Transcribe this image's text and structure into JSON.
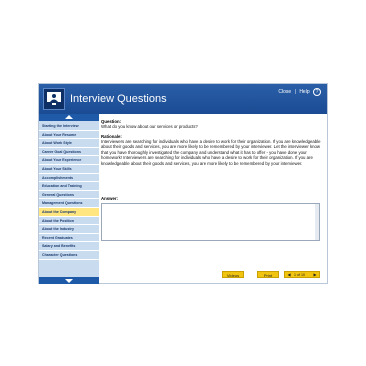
{
  "header": {
    "title": "Interview Questions",
    "close_label": "Close",
    "separator": "|",
    "help_label": "Help",
    "help_glyph": "?"
  },
  "sidebar": {
    "items": [
      {
        "label": "Starting the Interview",
        "active": false
      },
      {
        "label": "About Your Resume",
        "active": false
      },
      {
        "label": "About Work Style",
        "active": false
      },
      {
        "label": "Career Goal Questions",
        "active": false
      },
      {
        "label": "About Your Experience",
        "active": false
      },
      {
        "label": "About Your Skills",
        "active": false
      },
      {
        "label": "Accomplishments",
        "active": false
      },
      {
        "label": "Education and Training",
        "active": false
      },
      {
        "label": "General Questions",
        "active": false
      },
      {
        "label": "Management Questions",
        "active": false
      },
      {
        "label": "About the Company",
        "active": true
      },
      {
        "label": "About the Position",
        "active": false
      },
      {
        "label": "About the Industry",
        "active": false
      },
      {
        "label": "Recent Graduates",
        "active": false
      },
      {
        "label": "Salary and Benefits",
        "active": false
      },
      {
        "label": "Character Questions",
        "active": false
      }
    ]
  },
  "content": {
    "question_label": "Question:",
    "question_text": "What do you know about our services or products?",
    "rationale_label": "Rationale:",
    "rationale_text": "Interviewers are searching for individuals who have a desire to work for their organization. If you are knowledgeable about their goods and services, you are more likely to be remembered by your interviewer. Let the interviewer know that you have thoroughly investigated the company and understand what it has to offer - you have done your homework! Interviewers are searching for individuals who have a desire to work for their organization. If you are knowledgeable about their goods and services, you are more likely to be remembered by your interviewer.",
    "answer_label": "Answer:",
    "answer_value": ""
  },
  "footer": {
    "videos_label": "Videos",
    "print_label": "Print",
    "pager_text": "1 of 10",
    "prev_glyph": "◀",
    "next_glyph": "▶"
  },
  "colors": {
    "header_blue": "#1f5399",
    "sidebar_bg": "#c9dbef",
    "active_item": "#ffe680",
    "button_yellow": "#f1c40f"
  }
}
